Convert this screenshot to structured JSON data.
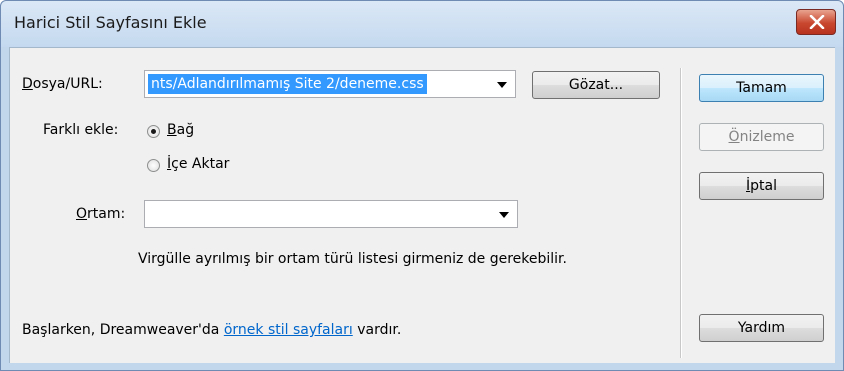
{
  "window": {
    "title": "Harici Stil Sayfasını Ekle"
  },
  "form": {
    "file_url_label_mn": "D",
    "file_url_label_rest": "osya/URL:",
    "file_url_value": "nts/Adlandırılmamış Site 2/deneme.css",
    "browse_label": "Gözat...",
    "add_as_label": "Farklı ekle:",
    "radio_link_mn": "B",
    "radio_link_rest": "ağ",
    "radio_link_checked": true,
    "radio_import_mn": "İ",
    "radio_import_rest": "çe Aktar",
    "radio_import_checked": false,
    "media_label_mn": "O",
    "media_label_rest": "rtam:",
    "media_value": "",
    "hint": "Virgülle ayrılmış bir ortam türü listesi girmeniz de gerekebilir."
  },
  "buttons": {
    "ok": "Tamam",
    "preview_mn": "Ö",
    "preview_rest": "nizleme",
    "cancel_mn": "İ",
    "cancel_rest": "ptal",
    "help": "Yardım"
  },
  "footer": {
    "prefix": "Başlarken, Dreamweaver'da ",
    "link": "örnek stil sayfaları",
    "suffix": " vardır."
  },
  "colors": {
    "selection": "#3399ff",
    "link": "#0066cc",
    "close_button": "#c9472f"
  },
  "icons": {
    "close": "close-icon",
    "dropdown": "chevron-down-icon"
  }
}
